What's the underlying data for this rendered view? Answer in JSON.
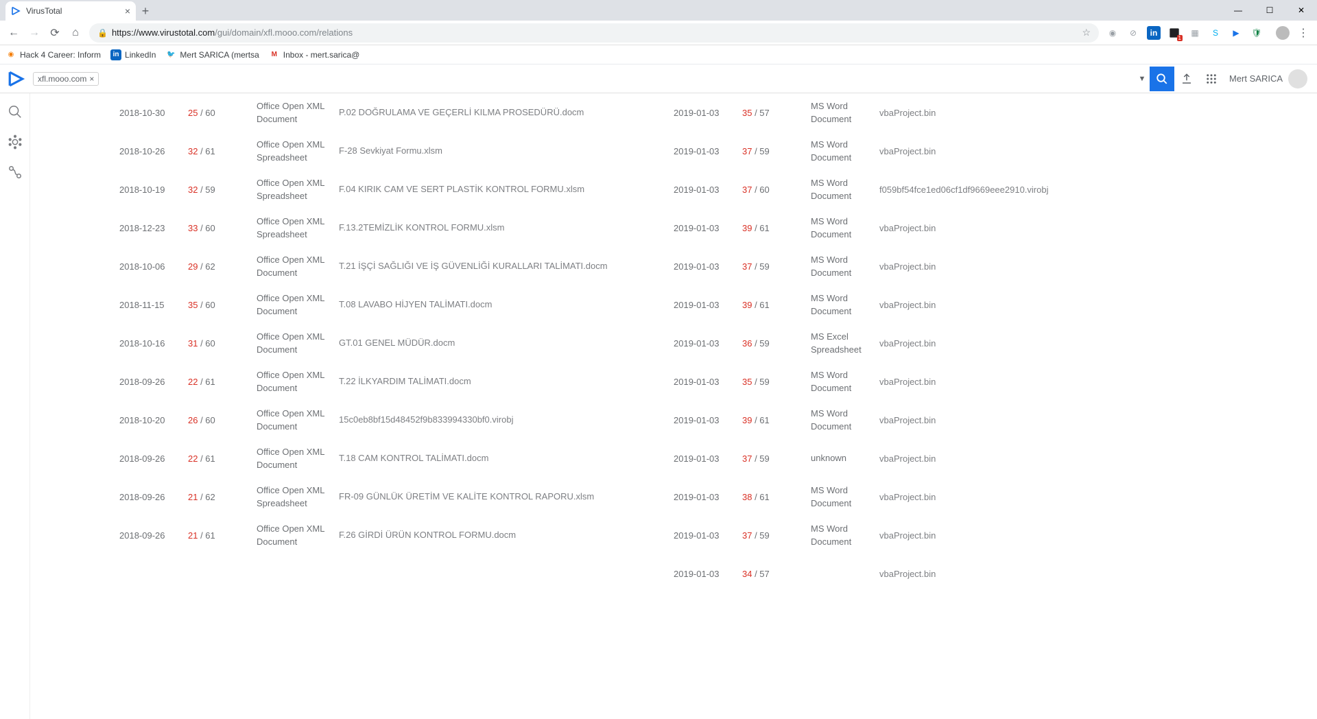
{
  "browser": {
    "tab_title": "VirusTotal",
    "url_scheme_host": "https://www.virustotal.com",
    "url_path": "/gui/domain/xfl.mooo.com/relations",
    "bookmarks": [
      {
        "icon_bg": "#f57c00",
        "icon_txt": "●",
        "label": "Hack 4 Career: Inform"
      },
      {
        "icon_bg": "#0a66c2",
        "icon_txt": "in",
        "label": "LinkedIn"
      },
      {
        "icon_bg": "#1da1f2",
        "icon_txt": "🐦",
        "label": "Mert SARICA (mertsa"
      },
      {
        "icon_bg": "#fff",
        "icon_txt": "M",
        "label": "Inbox - mert.sarica@"
      }
    ]
  },
  "vt": {
    "search_chip": "xfl.mooo.com",
    "user": "Mert SARICA"
  },
  "left_rows": [
    {
      "date": "2018-10-30",
      "pos": "25",
      "total": "60",
      "type": "Office Open XML Document",
      "name": "P.02 DOĞRULAMA VE GEÇERLİ KILMA PROSEDÜRÜ.docm"
    },
    {
      "date": "2018-10-26",
      "pos": "32",
      "total": "61",
      "type": "Office Open XML Spreadsheet",
      "name": "F-28 Sevkiyat Formu.xlsm"
    },
    {
      "date": "2018-10-19",
      "pos": "32",
      "total": "59",
      "type": "Office Open XML Spreadsheet",
      "name": "F.04 KIRIK CAM VE SERT PLASTİK KONTROL FORMU.xlsm"
    },
    {
      "date": "2018-12-23",
      "pos": "33",
      "total": "60",
      "type": "Office Open XML Spreadsheet",
      "name": "F.13.2TEMİZLİK KONTROL FORMU.xlsm"
    },
    {
      "date": "2018-10-06",
      "pos": "29",
      "total": "62",
      "type": "Office Open XML Document",
      "name": "T.21 İŞÇİ SAĞLIĞI VE İŞ GÜVENLİĞİ KURALLARI TALİMATI.docm"
    },
    {
      "date": "2018-11-15",
      "pos": "35",
      "total": "60",
      "type": "Office Open XML Document",
      "name": "T.08 LAVABO HİJYEN TALİMATI.docm"
    },
    {
      "date": "2018-10-16",
      "pos": "31",
      "total": "60",
      "type": "Office Open XML Document",
      "name": "GT.01 GENEL MÜDÜR.docm"
    },
    {
      "date": "2018-09-26",
      "pos": "22",
      "total": "61",
      "type": "Office Open XML Document",
      "name": "T.22 İLKYARDIM TALİMATI.docm"
    },
    {
      "date": "2018-10-20",
      "pos": "26",
      "total": "60",
      "type": "Office Open XML Document",
      "name": "15c0eb8bf15d48452f9b833994330bf0.virobj"
    },
    {
      "date": "2018-09-26",
      "pos": "22",
      "total": "61",
      "type": "Office Open XML Document",
      "name": "T.18 CAM KONTROL TALİMATI.docm"
    },
    {
      "date": "2018-09-26",
      "pos": "21",
      "total": "62",
      "type": "Office Open XML Spreadsheet",
      "name": "FR-09 GÜNLÜK ÜRETİM VE KALİTE KONTROL RAPORU.xlsm"
    },
    {
      "date": "2018-09-26",
      "pos": "21",
      "total": "61",
      "type": "Office Open XML Document",
      "name": "F.26 GİRDİ ÜRÜN KONTROL FORMU.docm"
    }
  ],
  "right_rows": [
    {
      "date": "2019-01-03",
      "pos": "35",
      "total": "57",
      "type": "MS Word Document",
      "name": "vbaProject.bin"
    },
    {
      "date": "2019-01-03",
      "pos": "37",
      "total": "59",
      "type": "MS Word Document",
      "name": "vbaProject.bin"
    },
    {
      "date": "2019-01-03",
      "pos": "37",
      "total": "60",
      "type": "MS Word Document",
      "name": "f059bf54fce1ed06cf1df9669eee2910.virobj"
    },
    {
      "date": "2019-01-03",
      "pos": "39",
      "total": "61",
      "type": "MS Word Document",
      "name": "vbaProject.bin"
    },
    {
      "date": "2019-01-03",
      "pos": "37",
      "total": "59",
      "type": "MS Word Document",
      "name": "vbaProject.bin"
    },
    {
      "date": "2019-01-03",
      "pos": "39",
      "total": "61",
      "type": "MS Word Document",
      "name": "vbaProject.bin"
    },
    {
      "date": "2019-01-03",
      "pos": "36",
      "total": "59",
      "type": "MS Excel Spreadsheet",
      "name": "vbaProject.bin"
    },
    {
      "date": "2019-01-03",
      "pos": "35",
      "total": "59",
      "type": "MS Word Document",
      "name": "vbaProject.bin"
    },
    {
      "date": "2019-01-03",
      "pos": "39",
      "total": "61",
      "type": "MS Word Document",
      "name": "vbaProject.bin"
    },
    {
      "date": "2019-01-03",
      "pos": "37",
      "total": "59",
      "type": "unknown",
      "name": "vbaProject.bin"
    },
    {
      "date": "2019-01-03",
      "pos": "38",
      "total": "61",
      "type": "MS Word Document",
      "name": "vbaProject.bin"
    },
    {
      "date": "2019-01-03",
      "pos": "37",
      "total": "59",
      "type": "MS Word Document",
      "name": "vbaProject.bin"
    },
    {
      "date": "2019-01-03",
      "pos": "34",
      "total": "57",
      "type": "",
      "name": "vbaProject.bin"
    }
  ]
}
